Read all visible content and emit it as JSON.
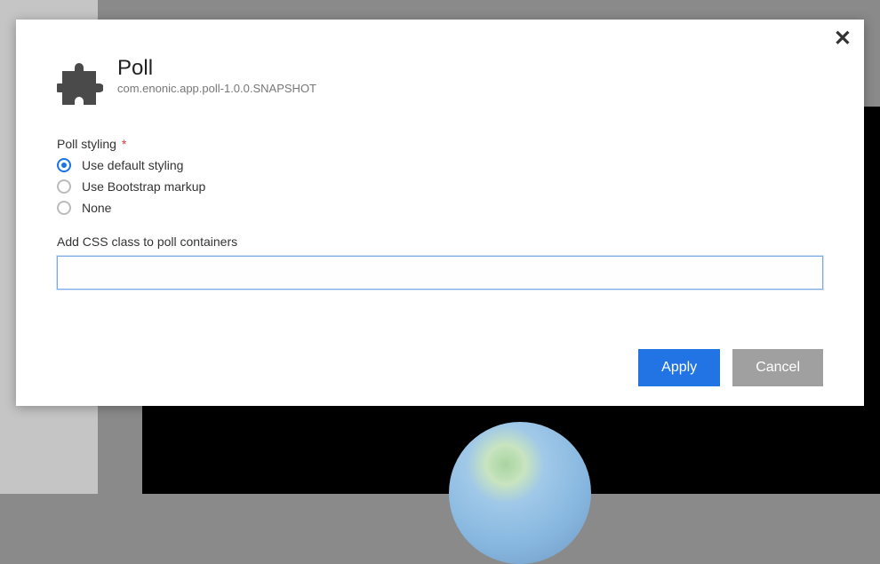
{
  "modal": {
    "title": "Poll",
    "subtitle": "com.enonic.app.poll-1.0.0.SNAPSHOT",
    "close_glyph": "✕"
  },
  "form": {
    "styling_label": "Poll styling",
    "required_marker": "*",
    "options": [
      {
        "label": "Use default styling",
        "checked": true
      },
      {
        "label": "Use Bootstrap markup",
        "checked": false
      },
      {
        "label": "None",
        "checked": false
      }
    ],
    "css_class_label": "Add CSS class to poll containers",
    "css_class_value": ""
  },
  "buttons": {
    "apply": "Apply",
    "cancel": "Cancel"
  }
}
